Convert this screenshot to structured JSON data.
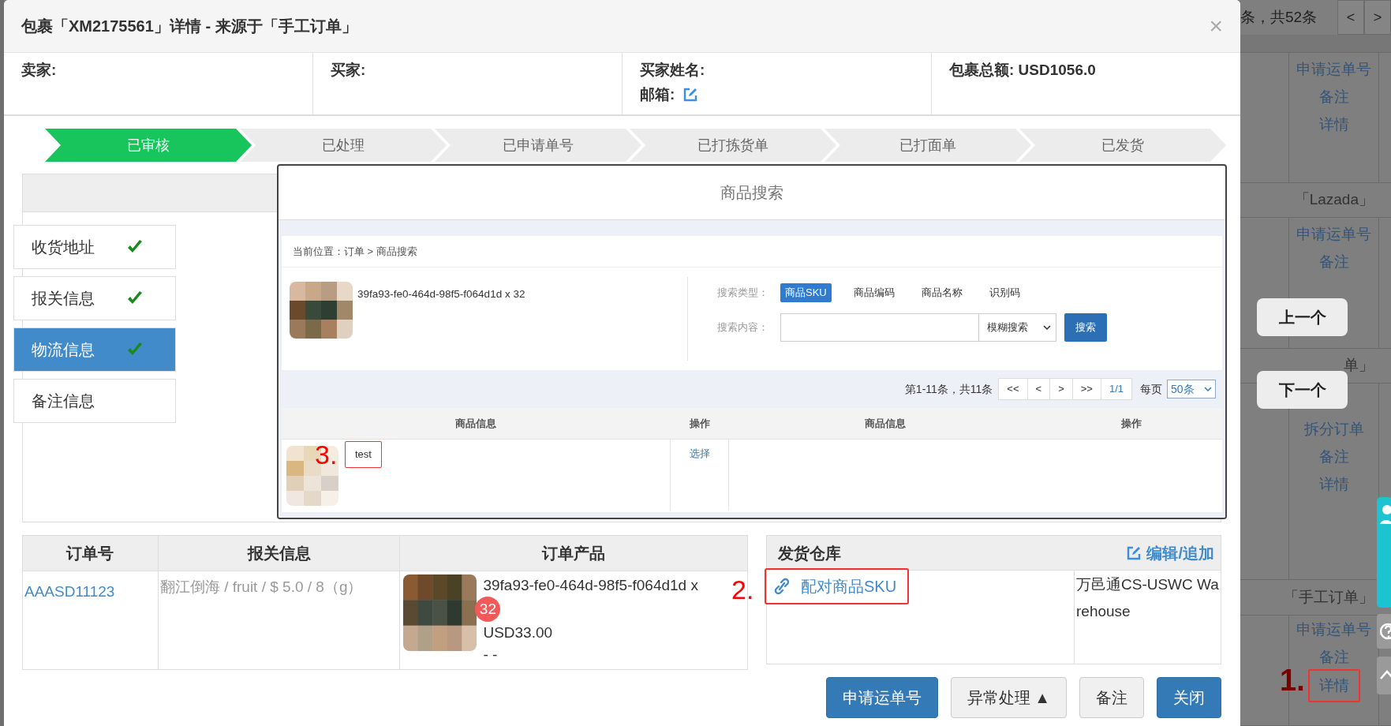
{
  "background_page": {
    "pager_text": "条，共52条",
    "pager_buttons": [
      "<",
      ">"
    ],
    "rows": [
      {
        "kind": "actions",
        "links": [
          {
            "label": "申请运单号",
            "highlighted": false
          },
          {
            "label": "备注",
            "highlighted": false
          },
          {
            "label": "详情",
            "highlighted": false
          }
        ]
      },
      {
        "kind": "group",
        "label": "「Lazada」"
      },
      {
        "kind": "actions",
        "links": [
          {
            "label": "申请运单号",
            "highlighted": false
          },
          {
            "label": "备注",
            "highlighted": false
          }
        ]
      },
      {
        "kind": "group",
        "label": "单」"
      },
      {
        "kind": "actions",
        "links": [
          {
            "label": "拆分订单",
            "highlighted": false
          },
          {
            "label": "备注",
            "highlighted": false
          },
          {
            "label": "详情",
            "highlighted": false
          }
        ]
      },
      {
        "kind": "group",
        "label": "「手工订单」"
      },
      {
        "kind": "actions",
        "links": [
          {
            "label": "申请运单号",
            "highlighted": false
          },
          {
            "label": "备注",
            "highlighted": false
          },
          {
            "label": "详情",
            "highlighted": true,
            "annotation": "1."
          }
        ]
      }
    ],
    "nav_buttons": [
      "上一个",
      "下一个"
    ]
  },
  "dialog": {
    "title": "包裹「XM2175561」详情 - 来源于「手工订单」",
    "close": "×",
    "info_cells": [
      {
        "lines": [
          {
            "text": "卖家:",
            "edit_icon": false
          }
        ]
      },
      {
        "lines": [
          {
            "text": "买家:",
            "edit_icon": false
          }
        ]
      },
      {
        "lines": [
          {
            "text": "买家姓名:",
            "edit_icon": false
          },
          {
            "text": "邮箱:",
            "edit_icon": true
          }
        ]
      },
      {
        "lines": [
          {
            "text": "包裹总额: USD1056.0",
            "edit_icon": false
          }
        ]
      }
    ],
    "steps": [
      {
        "label": "已审核",
        "selected": true
      },
      {
        "label": "已处理",
        "selected": false
      },
      {
        "label": "已申请单号",
        "selected": false
      },
      {
        "label": "已打拣货单",
        "selected": false
      },
      {
        "label": "已打面单",
        "selected": false
      },
      {
        "label": "已发货",
        "selected": false
      }
    ],
    "side_nav": [
      {
        "label": "收货地址",
        "done": true,
        "selected": false
      },
      {
        "label": "报关信息",
        "done": true,
        "selected": false
      },
      {
        "label": "物流信息",
        "done": true,
        "selected": true
      },
      {
        "label": "备注信息",
        "done": false,
        "selected": false
      }
    ],
    "search_dialog": {
      "title": "商品搜索",
      "breadcrumb": "当前位置：订单 > 商品搜索",
      "product_sku": "39fa93-fe0-464d-98f5-f064d1d x  32",
      "type_label": "搜索类型：",
      "search_types": [
        {
          "label": "商品SKU",
          "selected": true
        },
        {
          "label": "商品编码",
          "selected": false
        },
        {
          "label": "商品名称",
          "selected": false
        },
        {
          "label": "识别码",
          "selected": false
        }
      ],
      "content_label": "搜索内容：",
      "match_select": "模糊搜索",
      "search_button": "搜索",
      "pager": {
        "summary": "第1-11条，共11条",
        "buttons": [
          "<<",
          "<",
          ">",
          ">>"
        ],
        "page": "1/1",
        "per_page_label": "每页",
        "per_page": "50条"
      },
      "columns": [
        "商品信息",
        "操作",
        "商品信息",
        "操作"
      ],
      "rows": [
        {
          "name": "test",
          "action": "选择",
          "annotation": "3."
        }
      ]
    },
    "order_table": {
      "columns": [
        "订单号",
        "报关信息",
        "订单产品"
      ],
      "rows": [
        {
          "order_no": "AAASD11123",
          "customs": "翻江倒海 / fruit / $ 5.0 / 8（g）",
          "sku": "39fa93-fe0-464d-98f5-f064d1d x",
          "qty": "32",
          "price": "USD33.00",
          "note": "- -"
        }
      ]
    },
    "warehouse": {
      "title": "发货仓库",
      "edit": "编辑/追加",
      "match_link": "配对商品SKU",
      "annotation": "2.",
      "name": "万邑通CS-USWC Warehouse"
    },
    "footer_buttons": [
      {
        "label": "申请运单号",
        "kind": "primary"
      },
      {
        "label": "异常处理",
        "caret": "▲",
        "kind": "default"
      },
      {
        "label": "备注",
        "kind": "default"
      },
      {
        "label": "关闭",
        "kind": "primary"
      }
    ]
  }
}
